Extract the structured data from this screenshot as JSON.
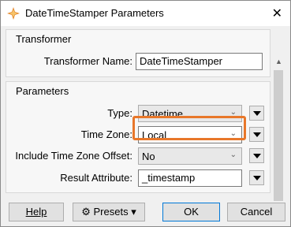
{
  "window": {
    "title": "DateTimeStamper Parameters",
    "close_icon": "close-icon"
  },
  "transformer": {
    "group_title": "Transformer",
    "name_label": "Transformer Name:",
    "name_value": "DateTimeStamper"
  },
  "parameters": {
    "group_title": "Parameters",
    "type_label": "Type:",
    "type_value": "Datetime",
    "timezone_label": "Time Zone:",
    "timezone_value": "Local",
    "include_offset_label": "Include Time Zone Offset:",
    "include_offset_value": "No",
    "result_attr_label": "Result Attribute:",
    "result_attr_value": "_timestamp"
  },
  "footer": {
    "help_label": "Help",
    "presets_label": "Presets",
    "ok_label": "OK",
    "cancel_label": "Cancel"
  },
  "colors": {
    "highlight": "#e8772a",
    "default_button_border": "#0078d7"
  }
}
